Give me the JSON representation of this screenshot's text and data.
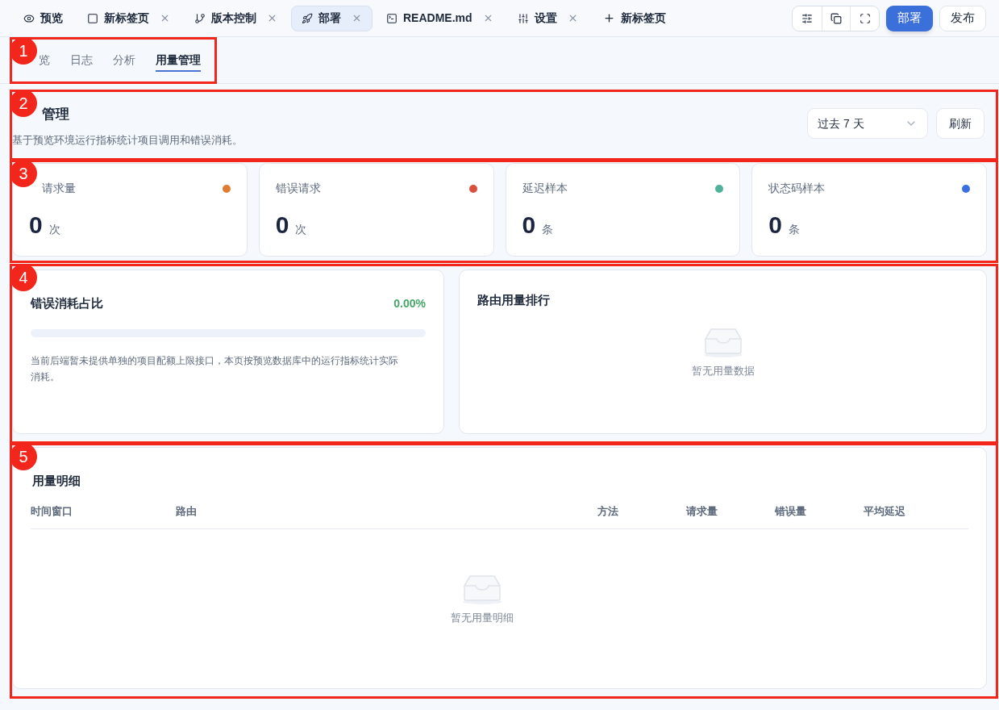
{
  "tabs": [
    {
      "label": "预览",
      "closable": false,
      "selected": false
    },
    {
      "label": "新标签页",
      "closable": true,
      "selected": false
    },
    {
      "label": "版本控制",
      "closable": true,
      "selected": false
    },
    {
      "label": "部署",
      "closable": true,
      "selected": true
    },
    {
      "label": "README.md",
      "closable": true,
      "selected": false
    },
    {
      "label": "设置",
      "closable": true,
      "selected": false
    }
  ],
  "new_tab": "新标签页",
  "deploy_button": "部署",
  "publish_button": "发布",
  "sub_tabs": [
    {
      "label": "览",
      "selected": false
    },
    {
      "label": "日志",
      "selected": false
    },
    {
      "label": "分析",
      "selected": false
    },
    {
      "label": "用量管理",
      "selected": true
    }
  ],
  "header": {
    "title": "管理",
    "description": "基于预览环境运行指标统计项目调用和错误消耗。",
    "range": "过去 7 天",
    "refresh": "刷新"
  },
  "stats": [
    {
      "label": "请求量",
      "value": "0",
      "unit": "次",
      "color": "#e07b33"
    },
    {
      "label": "错误请求",
      "value": "0",
      "unit": "次",
      "color": "#d9503f"
    },
    {
      "label": "延迟样本",
      "value": "0",
      "unit": "条",
      "color": "#4fb39b"
    },
    {
      "label": "状态码样本",
      "value": "0",
      "unit": "条",
      "color": "#3b6ee3"
    }
  ],
  "error_ratio": {
    "title": "错误消耗占比",
    "percent": "0.00%",
    "level": 0,
    "note": "当前后端暂未提供单独的项目配额上限接口，本页按预览数据库中的运行指标统计实际消耗。"
  },
  "route_ranking": {
    "title": "路由用量排行",
    "empty": "暂无用量数据"
  },
  "details": {
    "title": "用量明细",
    "columns": [
      "时间窗口",
      "路由",
      "方法",
      "请求量",
      "错误量",
      "平均延迟"
    ],
    "empty": "暂无用量明细"
  },
  "annotations": [
    "1",
    "2",
    "3",
    "4",
    "5"
  ]
}
